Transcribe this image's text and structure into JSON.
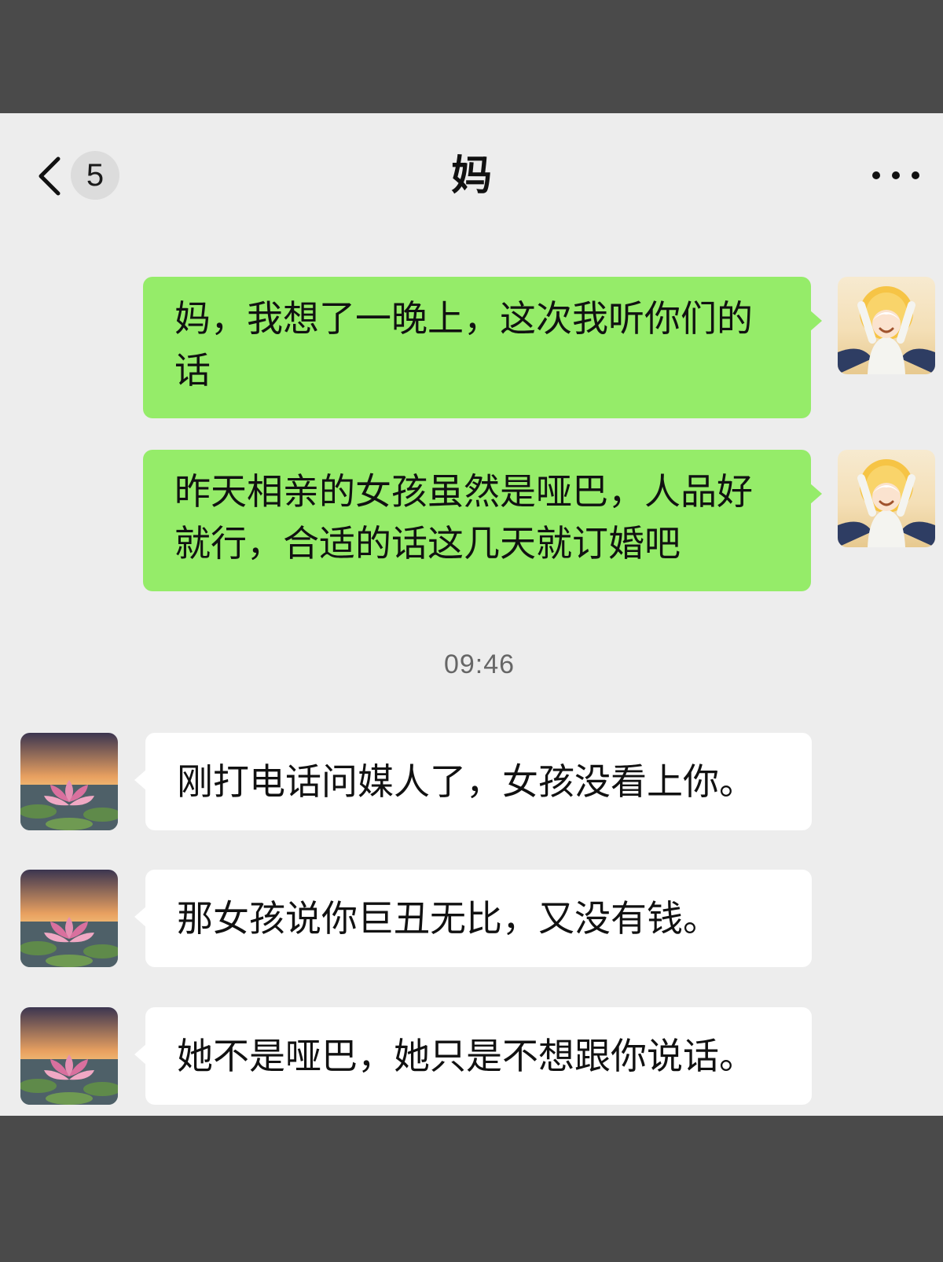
{
  "header": {
    "unread_count": "5",
    "title": "妈"
  },
  "messages_outgoing": [
    {
      "text": "妈，我想了一晚上，这次我听你们的话"
    },
    {
      "text": "昨天相亲的女孩虽然是哑巴，人品好就行，合适的话这几天就订婚吧"
    }
  ],
  "timestamp": "09:46",
  "messages_incoming": [
    {
      "text": "刚打电话问媒人了，女孩没看上你。"
    },
    {
      "text": "那女孩说你巨丑无比，又没有钱。"
    },
    {
      "text": "她不是哑巴，她只是不想跟你说话。"
    }
  ],
  "icons": {
    "back": "chevron-left-icon",
    "more": "more-dots-icon"
  },
  "colors": {
    "outgoing_bubble": "#95ec69",
    "incoming_bubble": "#ffffff",
    "chat_background": "#ededed"
  }
}
